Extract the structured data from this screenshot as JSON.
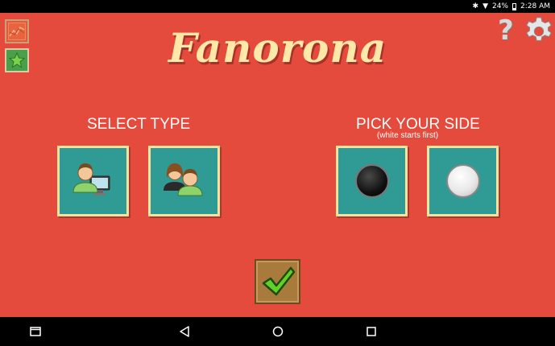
{
  "status_bar": {
    "battery": "24%",
    "time": "2:28 AM"
  },
  "app": {
    "title": "Fanorona",
    "select_type_label": "SELECT TYPE",
    "pick_side_label": "PICK YOUR SIDE",
    "pick_side_hint": "(white starts first)"
  },
  "colors": {
    "background": "#e54b3c",
    "tile": "#2f9b94",
    "tile_border": "#f4e4a0",
    "title": "#ffe9a8",
    "confirm": "#a87a3c"
  },
  "icons": {
    "graph_button": "graph-icon",
    "star_button": "star-icon",
    "help": "question-mark-icon",
    "settings": "gear-icon",
    "vs_computer": "person-computer-icon",
    "vs_human": "two-people-icon",
    "black_side": "black-stone-icon",
    "white_side": "white-stone-icon",
    "confirm": "checkmark-icon"
  }
}
